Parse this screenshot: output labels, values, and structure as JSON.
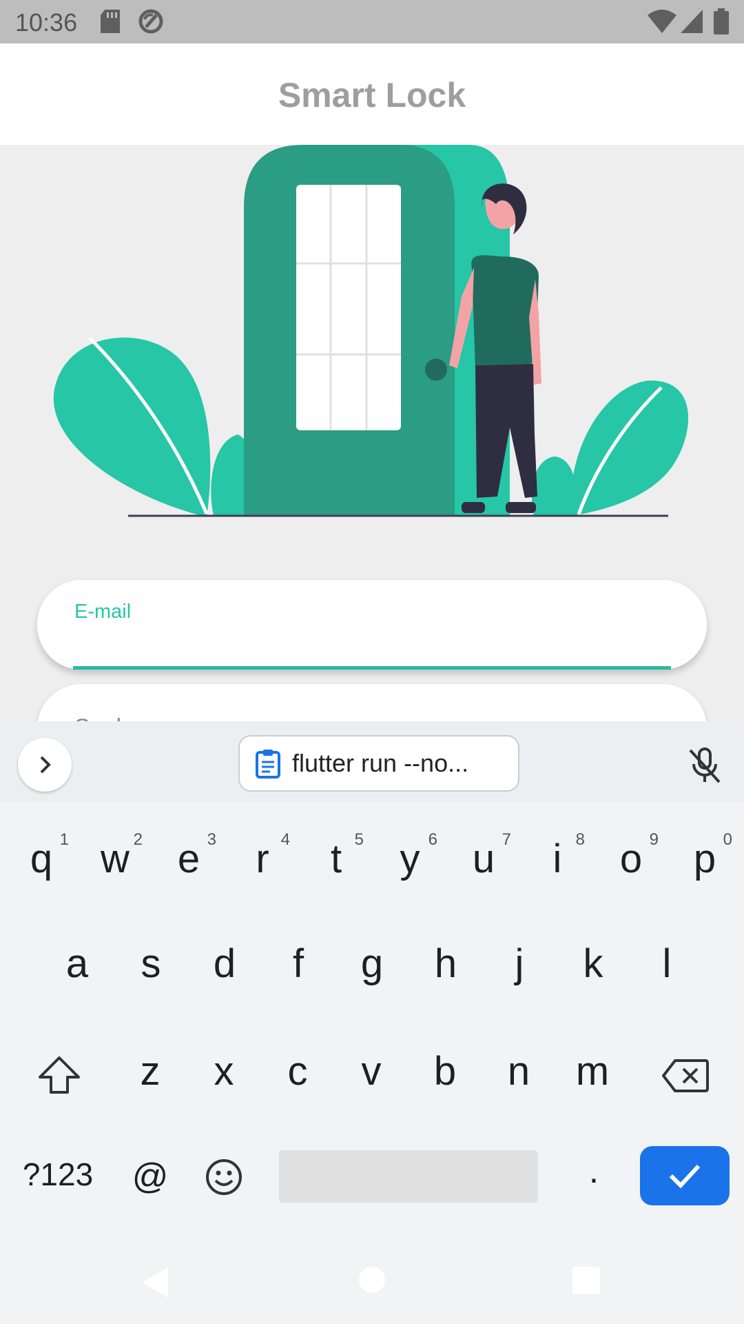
{
  "status_bar": {
    "time": "10:36",
    "icons": [
      "sd-card-icon",
      "vpn-lock-icon",
      "wifi-icon",
      "signal-icon",
      "battery-icon"
    ]
  },
  "app_bar": {
    "title": "Smart Lock"
  },
  "illustration": {
    "name": "person-at-door-illustration"
  },
  "form": {
    "email_label": "E-mail",
    "password_label": "Senha"
  },
  "keyboard": {
    "clipboard_suggestion": "flutter run --no...",
    "row1": [
      {
        "k": "q",
        "h": "1"
      },
      {
        "k": "w",
        "h": "2"
      },
      {
        "k": "e",
        "h": "3"
      },
      {
        "k": "r",
        "h": "4"
      },
      {
        "k": "t",
        "h": "5"
      },
      {
        "k": "y",
        "h": "6"
      },
      {
        "k": "u",
        "h": "7"
      },
      {
        "k": "i",
        "h": "8"
      },
      {
        "k": "o",
        "h": "9"
      },
      {
        "k": "p",
        "h": "0"
      }
    ],
    "row2": [
      "a",
      "s",
      "d",
      "f",
      "g",
      "h",
      "j",
      "k",
      "l"
    ],
    "row3": [
      "z",
      "x",
      "c",
      "v",
      "b",
      "n",
      "m"
    ],
    "symbols_key": "?123",
    "at_key": "@",
    "period_key": "."
  },
  "colors": {
    "accent": "#26c6a6",
    "door": "#2a9d84",
    "leaf": "#26c6a6",
    "enter": "#1a73e8"
  }
}
